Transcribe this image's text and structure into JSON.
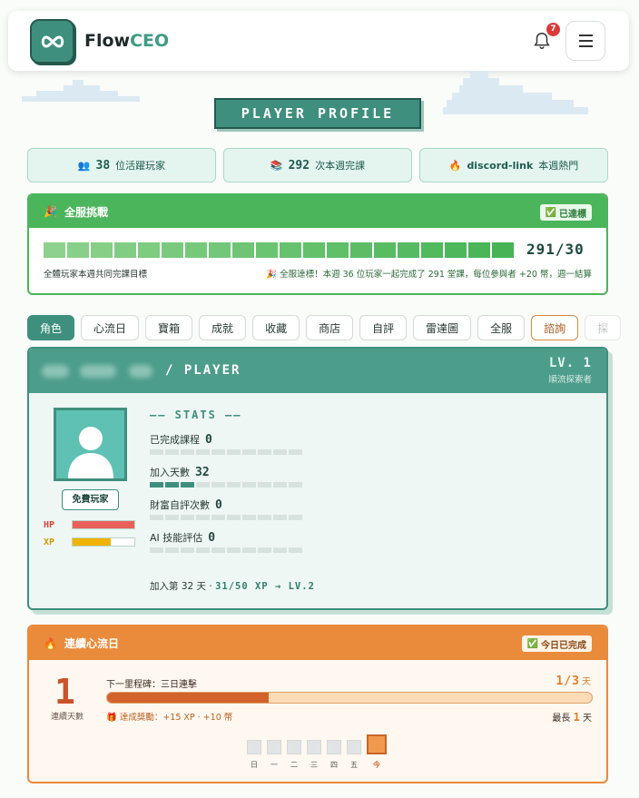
{
  "header": {
    "brand_part1": "Flow",
    "brand_part2": "CEO",
    "notification_count": "7"
  },
  "page_title": "PLAYER PROFILE",
  "stats_pills": [
    {
      "icon": "👥",
      "value": "38",
      "label": "位活躍玩家"
    },
    {
      "icon": "📚",
      "value": "292",
      "label": "次本週完課"
    },
    {
      "icon": "🔥",
      "value": "discord-link",
      "label": "本週熱門"
    }
  ],
  "challenge": {
    "icon": "🎉",
    "title": "全服挑戰",
    "badge": "已達標",
    "ratio": "291/30",
    "progress_fraction": 1.0,
    "segments": 20,
    "label": "全體玩家本週共同完課目標",
    "note": "🎉 全服達標！本週 36 位玩家一起完成了 291 堂課，每位參與者 +20 幣，週一結算"
  },
  "tabs": [
    {
      "label": "角色",
      "state": "active"
    },
    {
      "label": "心流日",
      "state": "normal"
    },
    {
      "label": "寶箱",
      "state": "normal"
    },
    {
      "label": "成就",
      "state": "normal"
    },
    {
      "label": "收藏",
      "state": "normal"
    },
    {
      "label": "商店",
      "state": "normal"
    },
    {
      "label": "自評",
      "state": "normal"
    },
    {
      "label": "雷達圖",
      "state": "normal"
    },
    {
      "label": "全服",
      "state": "normal"
    },
    {
      "label": "諮詢",
      "state": "outline"
    },
    {
      "label": "探",
      "state": "faded"
    }
  ],
  "player": {
    "name_suffix": "/ PLAYER",
    "level": "LV. 1",
    "rank": "順流探索者",
    "tier_badge": "免費玩家",
    "hp_label": "HP",
    "xp_label": "XP",
    "hp_fraction": 1.0,
    "xp_fraction": 0.62,
    "stats_title": "—— STATS ——",
    "stats": [
      {
        "label": "已完成課程",
        "value": "0",
        "filled": 0
      },
      {
        "label": "加入天數",
        "value": "32",
        "filled": 3
      },
      {
        "label": "財富自評次數",
        "value": "0",
        "filled": 0
      },
      {
        "label": "AI 技能評估",
        "value": "0",
        "filled": 0
      }
    ],
    "footer_prefix": "加入第 32 天 ·",
    "footer_xp": "31/50 XP → LV.2"
  },
  "streak": {
    "icon": "🔥",
    "title": "連續心流日",
    "badge": "今日已完成",
    "count": "1",
    "count_caption": "連續天數",
    "milestone": "下一里程碑：三日連擊",
    "fraction_text": "1/3",
    "fraction_unit": "天",
    "progress_fraction": 0.333,
    "reward": "🎁 達成獎勵：+15 XP · +10 幣",
    "longest_prefix": "最長",
    "longest_value": "1",
    "longest_unit": "天",
    "days": [
      "日",
      "一",
      "二",
      "三",
      "四",
      "五",
      "今"
    ]
  },
  "colors": {
    "primary": "#3f8f7e",
    "challenge_green": "#4bb55b",
    "streak_orange": "#ea8a3b",
    "hp_red": "#e8605a",
    "xp_yellow": "#f0b400"
  }
}
